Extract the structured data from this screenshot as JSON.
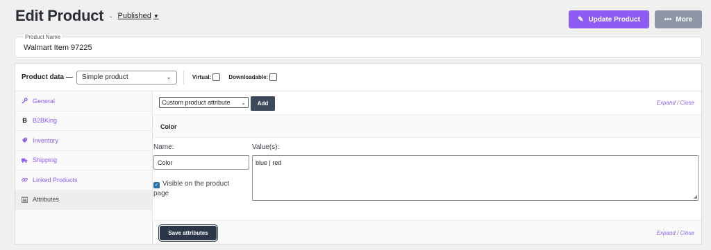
{
  "header": {
    "title": "Edit Product",
    "separator": "-",
    "status": "Published",
    "update_label": "Update Product",
    "more_label": "More"
  },
  "product_name": {
    "label": "Product Name",
    "value": "Walmart Item 97225"
  },
  "product_data": {
    "label": "Product data —",
    "type_selected": "Simple product",
    "virtual_label": "Virtual:",
    "virtual_checked": false,
    "downloadable_label": "Downloadable:",
    "downloadable_checked": false
  },
  "tabs": [
    {
      "label": "General",
      "icon": "wrench-icon"
    },
    {
      "label": "B2BKing",
      "icon": "b2bking-icon"
    },
    {
      "label": "Inventory",
      "icon": "tag-icon"
    },
    {
      "label": "Shipping",
      "icon": "truck-icon"
    },
    {
      "label": "Linked Products",
      "icon": "link-icon"
    },
    {
      "label": "Attributes",
      "icon": "list-icon",
      "active": true
    }
  ],
  "attributes": {
    "select_value": "Custom product attribute",
    "add_label": "Add",
    "expand": "Expand",
    "slash": "/",
    "close": "Close",
    "attr_title": "Color",
    "name_label": "Name:",
    "values_label": "Value(s):",
    "name_value": "Color",
    "values_value": "blue | red",
    "visible_label": "Visible on the product page",
    "visible_checked": true,
    "save_label": "Save attributes"
  },
  "colors": {
    "accent": "#8c5cf4",
    "more_button": "#8c96a4",
    "dark_button": "#2b3748"
  }
}
